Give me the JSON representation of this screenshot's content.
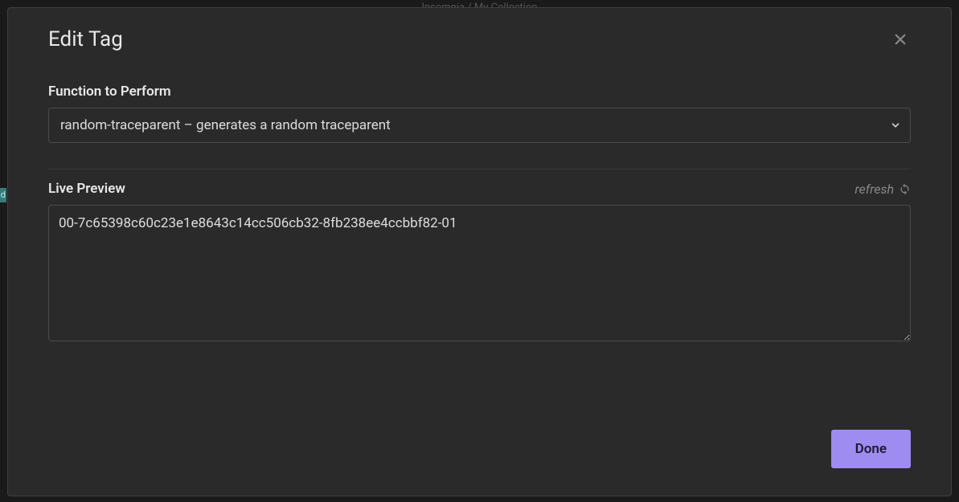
{
  "breadcrumb": "Insomnia  /  My Collection",
  "modal": {
    "title": "Edit Tag",
    "function_label": "Function to Perform",
    "function_selected": "random-traceparent – generates a random traceparent",
    "preview_label": "Live Preview",
    "refresh_label": "refresh",
    "preview_value": "00-7c65398c60c23e1e8643c14cc506cb32-8fb238ee4ccbbf82-01",
    "done_label": "Done"
  },
  "sidebar_fragment": "d"
}
